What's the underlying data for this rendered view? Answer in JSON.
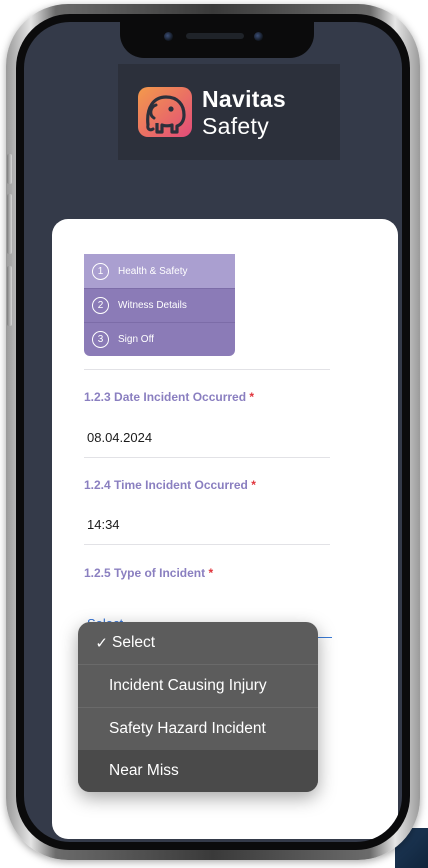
{
  "logo": {
    "line1": "Navitas",
    "line2": "Safety",
    "colors": {
      "gradient_start": "#f39a4b",
      "gradient_end": "#e24b7a",
      "panel": "#2c303b"
    },
    "icon": "elephant-logo-icon"
  },
  "stepper": {
    "steps": [
      {
        "number": "1",
        "label": "Health & Safety",
        "active": true
      },
      {
        "number": "2",
        "label": "Witness Details",
        "active": false
      },
      {
        "number": "3",
        "label": "Sign Off",
        "active": false
      }
    ]
  },
  "form": {
    "date": {
      "label": "1.2.3 Date Incident Occurred",
      "required_mark": "*",
      "value": "08.04.2024"
    },
    "time": {
      "label": "1.2.4 Time Incident Occurred",
      "required_mark": "*",
      "value": "14:34"
    },
    "type": {
      "label": "1.2.5 Type of Incident",
      "required_mark": "*",
      "value": "Select"
    }
  },
  "dropdown": {
    "selected_mark": "✓",
    "options": [
      {
        "label": "Select",
        "selected": true
      },
      {
        "label": "Incident Causing Injury",
        "selected": false
      },
      {
        "label": "Safety Hazard Incident",
        "selected": false
      },
      {
        "label": "Near Miss",
        "selected": false,
        "highlighted": true
      }
    ]
  },
  "colors": {
    "accent_purple": "#8a7fc0",
    "required_red": "#e0343c",
    "link_blue": "#2f6fd2",
    "screen_bg": "#343a49"
  }
}
